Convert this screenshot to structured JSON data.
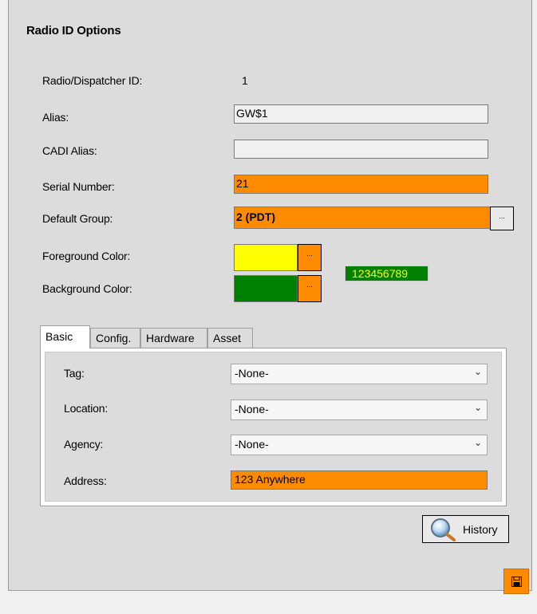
{
  "title": "Radio ID Options",
  "fields": {
    "radio_id_label": "Radio/Dispatcher ID:",
    "radio_id_value": "1",
    "alias_label": "Alias:",
    "alias_value": "GW$1",
    "cadi_label": "CADI Alias:",
    "cadi_value": "",
    "serial_label": "Serial Number:",
    "serial_value": "21",
    "group_label": "Default Group:",
    "group_value": "2 (PDT)",
    "fg_label": "Foreground Color:",
    "bg_label": "Background Color:",
    "ellipsis": "...",
    "preview_text": "123456789"
  },
  "colors": {
    "foreground": "#ffff00",
    "background": "#008000",
    "highlight": "#ff8c00"
  },
  "tabs": [
    {
      "label": "Basic",
      "active": true
    },
    {
      "label": "Config."
    },
    {
      "label": "Hardware"
    },
    {
      "label": "Asset"
    }
  ],
  "basic": {
    "tag_label": "Tag:",
    "tag_value": "-None-",
    "location_label": "Location:",
    "location_value": "-None-",
    "agency_label": "Agency:",
    "agency_value": "-None-",
    "address_label": "Address:",
    "address_value": "123 Anywhere"
  },
  "buttons": {
    "history_label": "History",
    "history_icon": "magnifier-icon",
    "save_icon": "floppy-disk-icon"
  }
}
